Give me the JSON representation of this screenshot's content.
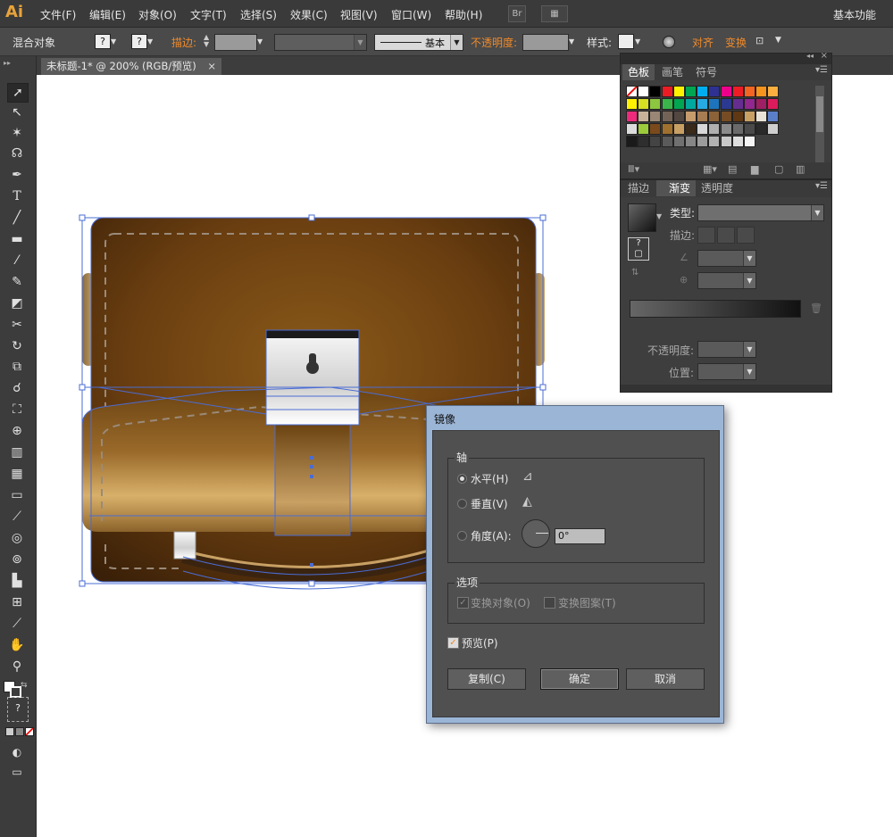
{
  "app": {
    "logo": "Ai",
    "workspace": "基本功能"
  },
  "menus": [
    "文件(F)",
    "编辑(E)",
    "对象(O)",
    "文字(T)",
    "选择(S)",
    "效果(C)",
    "视图(V)",
    "窗口(W)",
    "帮助(H)"
  ],
  "menubar_buttons": {
    "bridge": "Br",
    "arrange": "▦"
  },
  "control_bar": {
    "selection": "混合对象",
    "fill_value": "?",
    "stroke_value": "?",
    "stroke_label": "描边:",
    "stroke_style": "基本",
    "opacity_label": "不透明度:",
    "style_label": "样式:",
    "align_label": "对齐",
    "transform_label": "变换"
  },
  "document": {
    "tab_title": "未标题-1* @ 200% (RGB/预览)",
    "close": "×"
  },
  "swatch_panel": {
    "tabs": [
      "色板",
      "画笔",
      "符号"
    ],
    "swatch_colors": [
      [
        "none",
        "#ffffff",
        "#000000",
        "#ec1c24",
        "#fff200",
        "#00a651",
        "#00aeef",
        "#2e3192",
        "#ec008c",
        "#ee1c25",
        "#f26522",
        "#f7941d",
        "#fbaf3f"
      ],
      [
        "#fff200",
        "#d7df23",
        "#8dc63f",
        "#39b54a",
        "#00a651",
        "#00a99d",
        "#27aae1",
        "#1c75bc",
        "#2b3990",
        "#662d91",
        "#92278f",
        "#9e1f63",
        "#da1c5c"
      ],
      [
        "#ee2a7b",
        "#c7b299",
        "#998675",
        "#736357",
        "#534741",
        "#c69c6d",
        "#a67c52",
        "#8c6239",
        "#754c24",
        "#603813",
        "#c8a064",
        "#e8e2d6",
        "#5a7ec8"
      ],
      [
        "#dcdcdc",
        "#9ccb3b",
        "#7a4a1c",
        "#a0702e",
        "#c8a064",
        "#3a2a1a",
        "#d8d8d8",
        "#b0b0b0",
        "#8a8a8a",
        "#6a6a6a",
        "#4a4a4a",
        "#2a2a2a",
        "#cfcfcf"
      ],
      [
        "#1a1a1a",
        "#2e2e2e",
        "#444444",
        "#5a5a5a",
        "#707070",
        "#868686",
        "#9c9c9c",
        "#b2b2b2",
        "#c8c8c8",
        "#dedede",
        "#f4f4f4"
      ]
    ]
  },
  "gradient_panel": {
    "tabs": [
      "描边",
      "渐变",
      "透明度"
    ],
    "type_label": "类型:",
    "stroke_label": "描边:",
    "opacity_label": "不透明度:",
    "position_label": "位置:"
  },
  "dialog": {
    "title": "镜像",
    "axis_group": "轴",
    "horizontal": "水平(H)",
    "vertical": "垂直(V)",
    "angle": "角度(A):",
    "angle_value": "0°",
    "options_group": "选项",
    "transform_objects": "变换对象(O)",
    "transform_patterns": "变换图案(T)",
    "preview": "预览(P)",
    "copy_button": "复制(C)",
    "ok_button": "确定",
    "cancel_button": "取消",
    "selected_axis": "horizontal",
    "preview_checked": true
  },
  "colors": {
    "accent": "#f08a2a",
    "selection": "#4a6cd4",
    "leather_dark": "#4a2a0c",
    "leather_light": "#c8a064"
  }
}
